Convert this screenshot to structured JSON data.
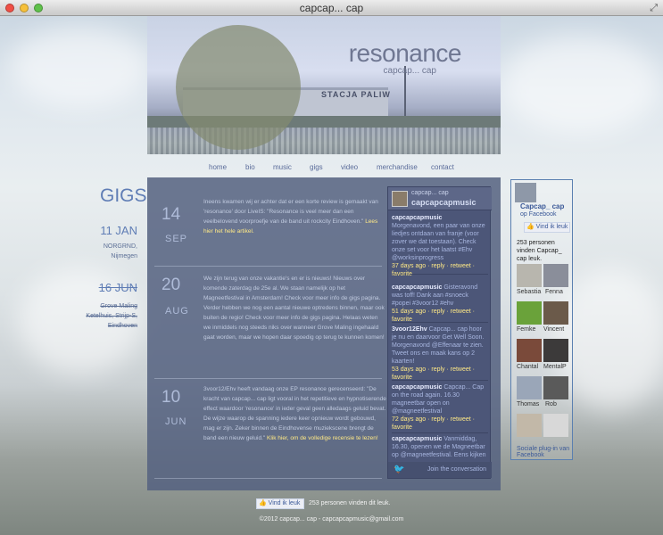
{
  "window": {
    "title": "capcap... cap"
  },
  "header": {
    "site_title": "resonance",
    "site_subtitle": "capcap... cap",
    "sign_text": "STACJA PALIW"
  },
  "nav": {
    "items": [
      "home",
      "bio",
      "music",
      "gigs",
      "video",
      "merchandise",
      "contact"
    ]
  },
  "gigs": {
    "heading": "GIGS",
    "items": [
      {
        "date": "11 JAN",
        "venue": "NORGRND,",
        "city": "Nijmegen",
        "past": false
      },
      {
        "date": "16 JUN",
        "venue": "Grove Maling",
        "city": "Ketelhuis, Strijp-S, Eindhoven",
        "past": true
      }
    ]
  },
  "posts": [
    {
      "day": "14",
      "month": "SEP",
      "text": "Ineens kwamen wij er achter dat er een korte review is gemaakt van 'resonance' door LiveIS: \"Resonance is veel meer dan een veelbelovend voorproefje van de band uit rockcity Eindhoven.\"",
      "link": "Lees hier het hele artikel."
    },
    {
      "day": "20",
      "month": "AUG",
      "text": "We zijn terug van onze vakantie's en er is nieuws! Nieuws over komende zaterdag de 25e al. We staan namelijk op het Magneetfestival in Amsterdam! Check voor meer info de gigs pagina. Verder hebben we nog een aantal nieuwe optredens binnen, maar ook buiten de regio! Check voor meer info de gigs pagina. Helaas weten we inmiddels nog steeds niks over wanneer Grove Maling ingehaald gaat worden, maar we hopen daar spoedig op terug te kunnen komen!",
      "link": ""
    },
    {
      "day": "10",
      "month": "JUN",
      "text": "3voor12/Ehv heeft vandaag onze EP resonance gerecenseerd: \"De kracht van capcap... cap ligt vooral in het repetitieve en hypnotiserende effect waardoor 'resonance' in ieder geval geen alledaags geluid bevat. De wijze waarop de spanning iedere keer opnieuw wordt gebouwd, mag er zijn. Zeker binnen de Eindhovense muziekscene brengt de band een nieuw geluid.\"",
      "link": "Klik hier, om de volledige recensie te lezen!"
    }
  ],
  "twitter": {
    "name": "capcap... cap",
    "handle": "capcapcapmusic",
    "tweets": [
      {
        "user": "capcapcapmusic",
        "text": "Morgenavond, een paar van onze liedjes ontdaan van franje (voor zover we dat toestaan). Check onze set voor het laatst #Ehv @worksinprogress",
        "meta": "37 days ago · reply · retweet · favorite"
      },
      {
        "user": "capcapcapmusic",
        "text": "Gisteravond was toff! Dank aan #snoeck #popei #3voor12 #ehv",
        "meta": "51 days ago · reply · retweet · favorite"
      },
      {
        "user": "3voor12Ehv",
        "text": "Capcap... cap hoor je nu en daarvoor Get Well Soon. Morgenavond @Effenaar te zien. Tweet ons en maak kans op 2 kaarten!",
        "meta": "53 days ago · reply · retweet · favorite"
      },
      {
        "user": "capcapcapmusic",
        "text": "Capcap... Cap on the road again. 16.30 magneetbar open on @magneetfestival",
        "meta": "72 days ago · reply · retweet · favorite"
      },
      {
        "user": "capcapcapmusic",
        "text": "Vanmiddag, 16.30, openen we de Magneetbar op @magneetfestival. Eens kijken",
        "meta": ""
      }
    ],
    "join": "Join the conversation"
  },
  "facebook": {
    "page_name": "Capcap_ cap",
    "sub": "op Facebook",
    "like_label": "Vind ik leuk",
    "count_text": "253 personen vinden Capcap_ cap leuk.",
    "fans": [
      "Sebastia",
      "Fenna",
      "Femke",
      "Vincent",
      "Chantal",
      "MentalP",
      "Thomas",
      "Rob",
      "",
      ""
    ],
    "plugin": "Sociale plug-in van Facebook"
  },
  "footer": {
    "like_label": "Vind ik leuk",
    "count_text": "253 personen vinden dit leuk.",
    "copyright": "©2012 capcap... cap - capcapcapmusic@gmail.com"
  },
  "colors": {
    "accent": "#5f7db5",
    "link": "#ffe986",
    "panel": "#556280",
    "facebook": "#3b5998"
  }
}
